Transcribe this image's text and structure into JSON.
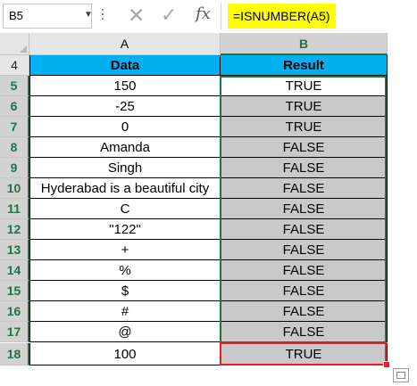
{
  "formula_bar": {
    "name_box": "B5",
    "cancel_icon": "✕",
    "enter_icon": "✓",
    "fx_label": "fx",
    "formula": "=ISNUMBER(A5)"
  },
  "columns": [
    "A",
    "B"
  ],
  "header_row": {
    "row_number": "4",
    "data": "Data",
    "result": "Result"
  },
  "rows": [
    {
      "n": "5",
      "data": "150",
      "result": "TRUE"
    },
    {
      "n": "6",
      "data": "-25",
      "result": "TRUE"
    },
    {
      "n": "7",
      "data": "0",
      "result": "TRUE"
    },
    {
      "n": "8",
      "data": "Amanda",
      "result": "FALSE"
    },
    {
      "n": "9",
      "data": "Singh",
      "result": "FALSE"
    },
    {
      "n": "10",
      "data": "Hyderabad is a beautiful city",
      "result": "FALSE"
    },
    {
      "n": "11",
      "data": "C",
      "result": "FALSE"
    },
    {
      "n": "12",
      "data": "\"122\"",
      "result": "FALSE"
    },
    {
      "n": "13",
      "data": "+",
      "result": "FALSE"
    },
    {
      "n": "14",
      "data": "%",
      "result": "FALSE"
    },
    {
      "n": "15",
      "data": "$",
      "result": "FALSE"
    },
    {
      "n": "16",
      "data": "#",
      "result": "FALSE"
    },
    {
      "n": "17",
      "data": "@",
      "result": "FALSE"
    },
    {
      "n": "18",
      "data": "100",
      "result": "TRUE"
    }
  ],
  "colors": {
    "header_fill": "#00b0f0",
    "result_fill": "#c9c9c9",
    "formula_highlight": "#ffff00",
    "selection_border": "#217346",
    "active_border": "#e8202a"
  }
}
